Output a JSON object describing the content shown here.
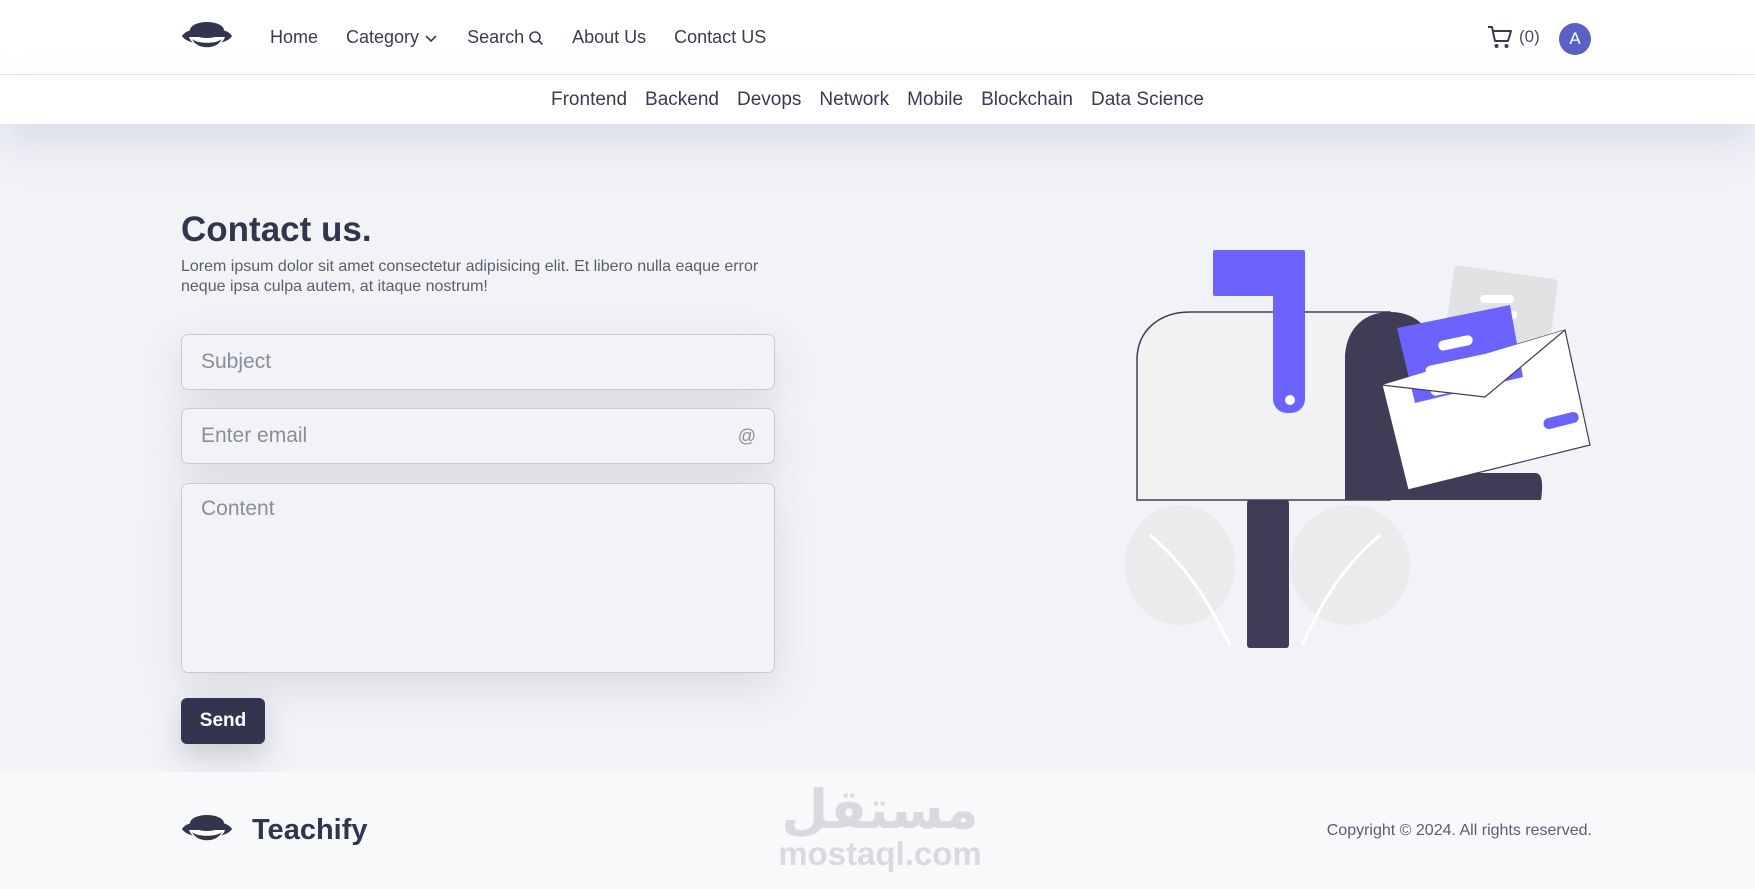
{
  "header": {
    "nav": [
      {
        "label": "Home",
        "icon": null
      },
      {
        "label": "Category",
        "icon": "chevron-down-icon"
      },
      {
        "label": "Search",
        "icon": "search-icon"
      },
      {
        "label": "About Us",
        "icon": null
      },
      {
        "label": "Contact US",
        "icon": null
      }
    ],
    "cart_count": "(0)",
    "avatar_letter": "A",
    "avatar_color": "#5a60c4"
  },
  "subnav": [
    "Frontend",
    "Backend",
    "Devops",
    "Network",
    "Mobile",
    "Blockchain",
    "Data Science"
  ],
  "contact": {
    "title": "Contact us.",
    "description": "Lorem ipsum dolor sit amet consectetur adipisicing elit. Et libero nulla eaque error neque ipsa culpa autem, at itaque nostrum!",
    "subject_placeholder": "Subject",
    "email_placeholder": "Enter email",
    "email_icon": "@",
    "content_placeholder": "Content",
    "send_label": "Send"
  },
  "illustration": {
    "name": "mailbox-illustration",
    "accent": "#6c63ff",
    "dark": "#3f3d56"
  },
  "footer": {
    "brand": "Teachify",
    "copyright": "Copyright © 2024. All rights reserved.",
    "watermark_ar": "مستقل",
    "watermark_en": "mostaql.com"
  }
}
